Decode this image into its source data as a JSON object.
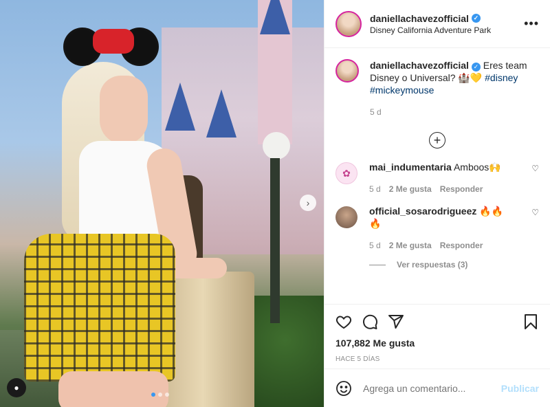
{
  "post": {
    "username": "daniellachavezofficial",
    "location": "Disney California Adventure Park",
    "caption_text": "Eres team Disney o Universal? 🏰💛",
    "hashtags": [
      "#disney",
      "#mickeymouse"
    ],
    "caption_time": "5 d",
    "likes": "107,882 Me gusta",
    "posted_ago": "HACE 5 DÍAS"
  },
  "comments": [
    {
      "username": "mai_indumentaria",
      "text": "Amboos🙌",
      "time": "5 d",
      "likes": "2 Me gusta",
      "reply_label": "Responder"
    },
    {
      "username": "official_sosarodrigueez",
      "text": "🔥🔥🔥",
      "time": "5 d",
      "likes": "2 Me gusta",
      "reply_label": "Responder",
      "view_replies": "Ver respuestas (3)"
    }
  ],
  "composer": {
    "placeholder": "Agrega un comentario...",
    "publish_label": "Publicar"
  },
  "carousel": {
    "total": 3,
    "current": 1
  },
  "icons": {
    "more": "more-options-icon",
    "verified": "verified-badge-icon",
    "like": "heart-icon",
    "comment": "comment-icon",
    "share": "share-icon",
    "save": "bookmark-icon",
    "emoji": "emoji-icon"
  },
  "colors": {
    "link": "#00376b",
    "accent": "#3897f0",
    "publish_disabled": "#b2dffc"
  }
}
